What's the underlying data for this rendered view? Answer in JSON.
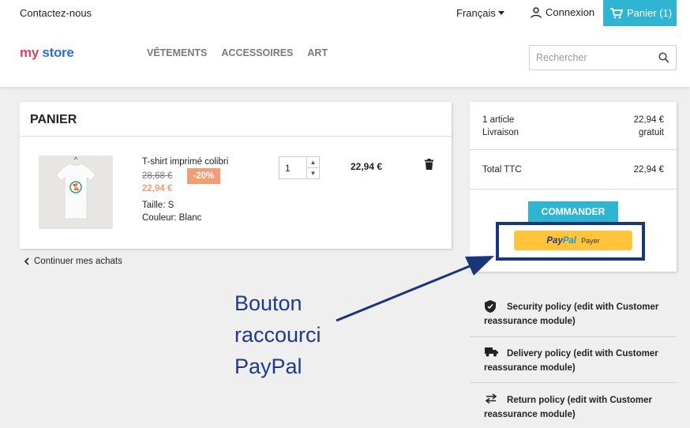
{
  "topbar": {
    "contact": "Contactez-nous",
    "language": "Français",
    "login": "Connexion",
    "cart": "Panier (1)"
  },
  "header": {
    "logo_word1": "my",
    "logo_word2": "store",
    "nav": [
      "VÊTEMENTS",
      "ACCESSOIRES",
      "ART"
    ],
    "search_placeholder": "Rechercher"
  },
  "cart": {
    "title": "PANIER",
    "item": {
      "name": "T-shirt imprimé colibri",
      "old_price": "28,68 €",
      "discount": "-20%",
      "price": "22,94 €",
      "size": "Taille: S",
      "color": "Couleur: Blanc",
      "quantity": "1",
      "line_total": "22,94 €"
    },
    "continue": "Continuer mes achats"
  },
  "summary": {
    "items_label": "1 article",
    "items_value": "22,94 €",
    "shipping_label": "Livraison",
    "shipping_value": "gratuit",
    "total_label": "Total TTC",
    "total_value": "22,94 €",
    "order_button": "COMMANDER",
    "paypal_word1": "Pay",
    "paypal_word2": "Pal",
    "paypal_payer": "Payer"
  },
  "annotation": {
    "line1": "Bouton",
    "line2": "raccourci",
    "line3": "PayPal"
  },
  "reassurance": [
    {
      "text": "Security policy (edit with Customer reassurance module)",
      "icon": "shield-icon"
    },
    {
      "text": "Delivery policy (edit with Customer reassurance module)",
      "icon": "truck-icon"
    },
    {
      "text": "Return policy (edit with Customer reassurance module)",
      "icon": "swap-arrows-icon"
    }
  ],
  "colors": {
    "accent": "#2fb5d2",
    "discount": "#f39d72",
    "paypal_button": "#ffc439",
    "annotation": "#1e3a8a"
  }
}
